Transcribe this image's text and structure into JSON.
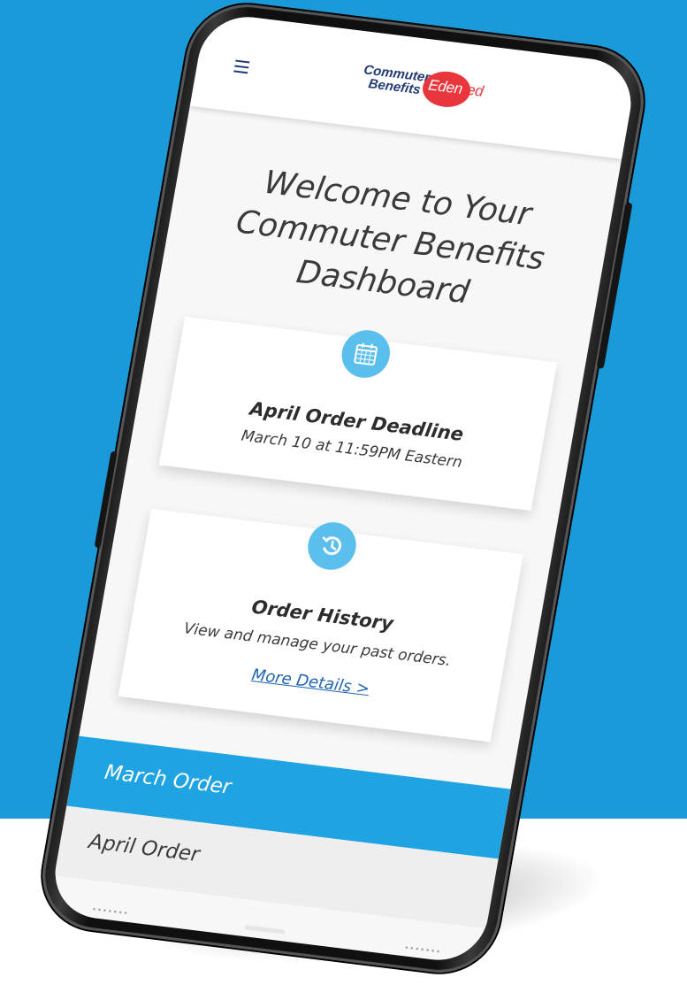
{
  "app": {
    "logo_line1": "Commuter",
    "logo_line2": "Benefits",
    "logo_brand_head": "Eden",
    "logo_brand_tail": "red"
  },
  "header": {
    "menu_icon": "hamburger-menu-icon"
  },
  "main": {
    "welcome_title": "Welcome to Your Commuter Benefits Dashboard",
    "cards": [
      {
        "icon": "calendar-icon",
        "title": "April Order Deadline",
        "subtitle": "March 10 at 11:59PM Eastern"
      },
      {
        "icon": "history-icon",
        "title": "Order History",
        "subtitle": "View and manage your past orders.",
        "link_label": "More Details >"
      }
    ],
    "order_tabs": [
      {
        "label": "March Order",
        "active": true
      },
      {
        "label": "April Order",
        "active": false
      }
    ]
  },
  "colors": {
    "background_blue": "#1a9ad9",
    "accent_blue": "#1fa3e3",
    "icon_blue": "#5bbfee",
    "brand_navy": "#233b74",
    "brand_red": "#e8363c",
    "link_blue": "#1f64b3"
  }
}
